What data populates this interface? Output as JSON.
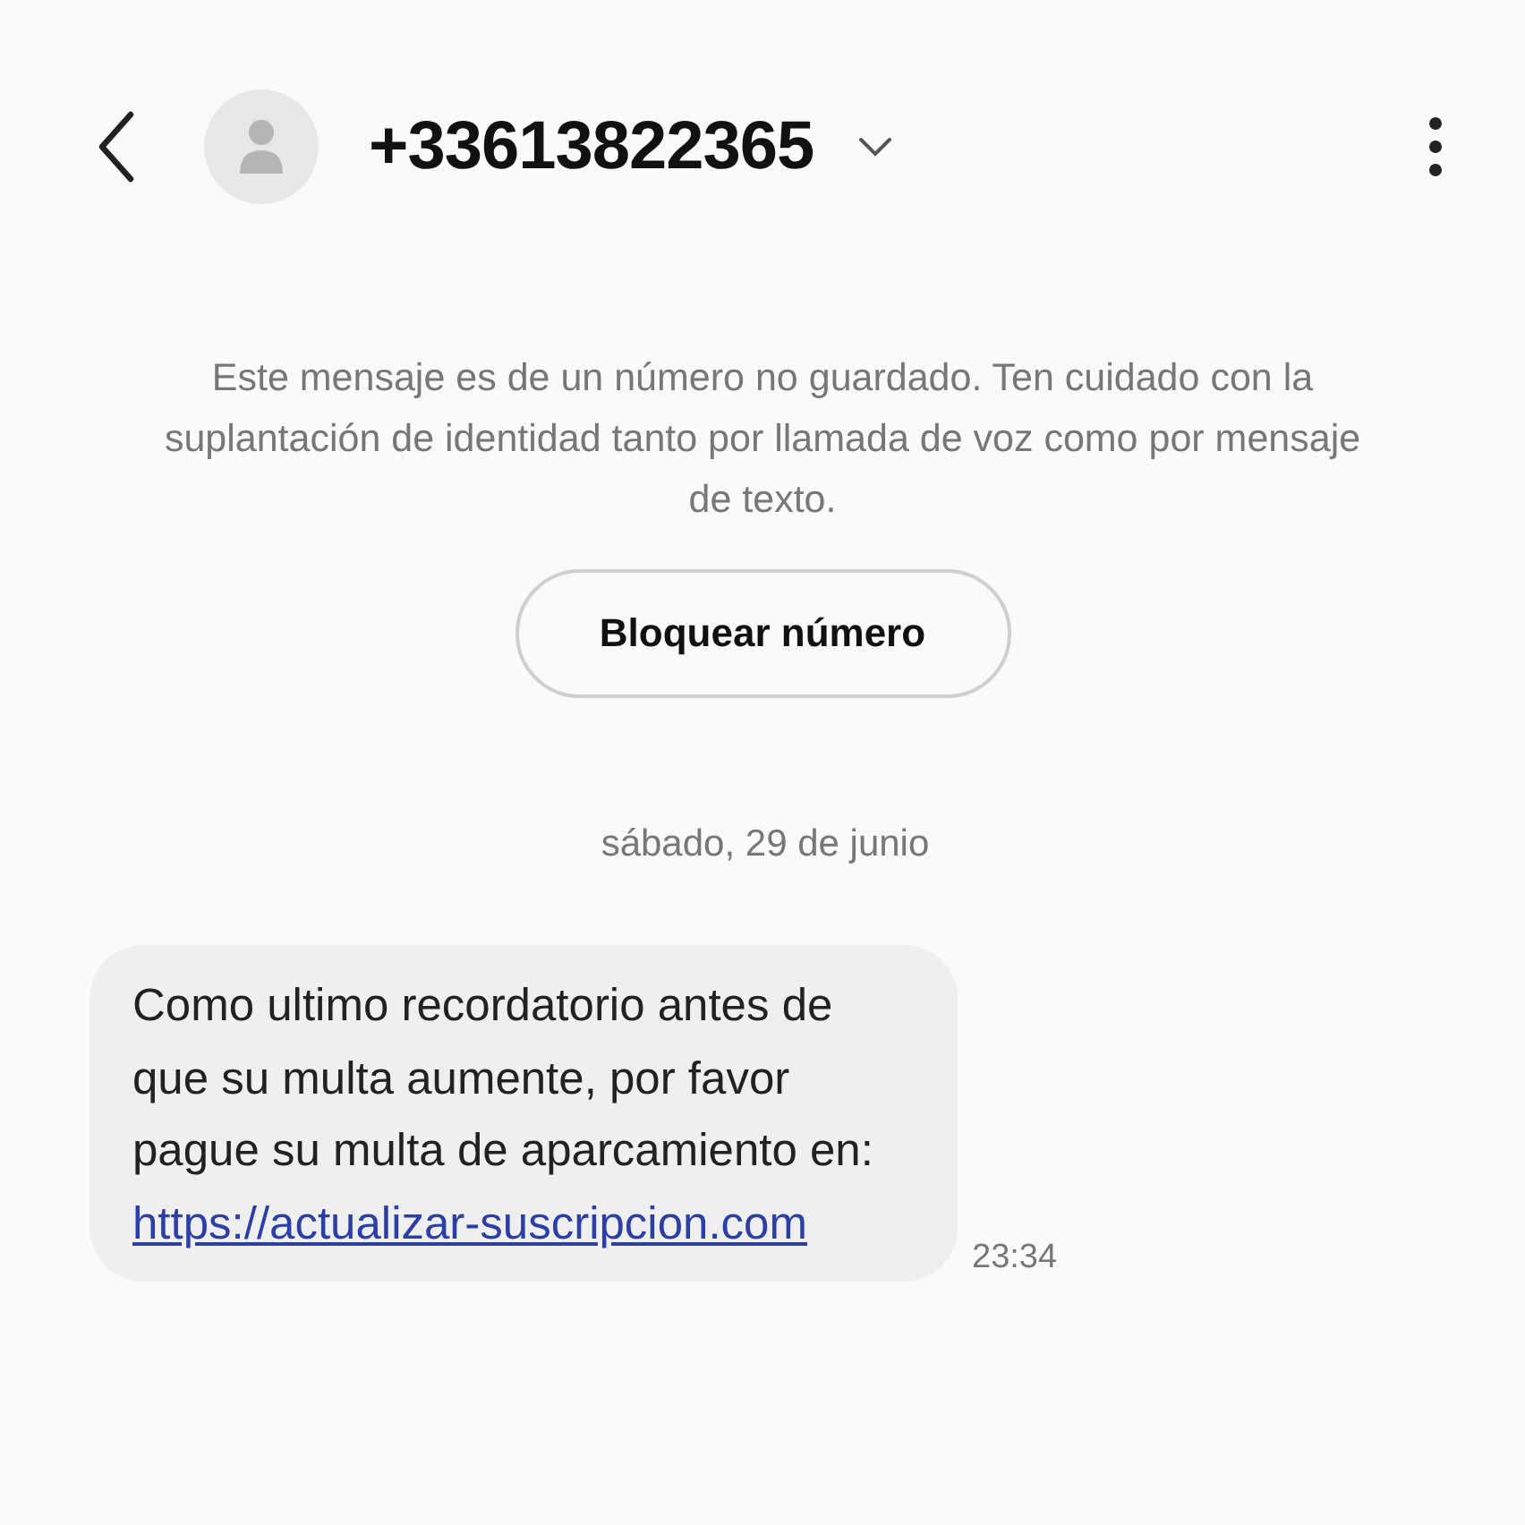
{
  "header": {
    "title": "+33613822365"
  },
  "notice": {
    "text": "Este mensaje es de un número no guardado. Ten cuidado con la suplantación de identidad tanto por llamada de voz como por mensaje de texto.",
    "button": "Bloquear número"
  },
  "date": "sábado, 29 de junio",
  "messages": [
    {
      "text": "Como ultimo recordatorio antes de que su multa aumente, por favor pague su multa de aparcamiento en:",
      "link": "https://actualizar-suscripcion.com",
      "time": "23:34"
    }
  ]
}
